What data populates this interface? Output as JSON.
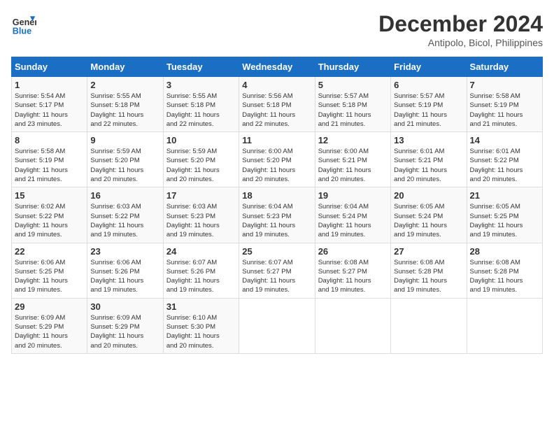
{
  "header": {
    "logo_line1": "General",
    "logo_line2": "Blue",
    "month": "December 2024",
    "location": "Antipolo, Bicol, Philippines"
  },
  "weekdays": [
    "Sunday",
    "Monday",
    "Tuesday",
    "Wednesday",
    "Thursday",
    "Friday",
    "Saturday"
  ],
  "weeks": [
    [
      {
        "day": 1,
        "sunrise": "5:54 AM",
        "sunset": "5:17 PM",
        "daylight": "11 hours and 23 minutes."
      },
      {
        "day": 2,
        "sunrise": "5:55 AM",
        "sunset": "5:18 PM",
        "daylight": "11 hours and 22 minutes."
      },
      {
        "day": 3,
        "sunrise": "5:55 AM",
        "sunset": "5:18 PM",
        "daylight": "11 hours and 22 minutes."
      },
      {
        "day": 4,
        "sunrise": "5:56 AM",
        "sunset": "5:18 PM",
        "daylight": "11 hours and 22 minutes."
      },
      {
        "day": 5,
        "sunrise": "5:57 AM",
        "sunset": "5:18 PM",
        "daylight": "11 hours and 21 minutes."
      },
      {
        "day": 6,
        "sunrise": "5:57 AM",
        "sunset": "5:19 PM",
        "daylight": "11 hours and 21 minutes."
      },
      {
        "day": 7,
        "sunrise": "5:58 AM",
        "sunset": "5:19 PM",
        "daylight": "11 hours and 21 minutes."
      }
    ],
    [
      {
        "day": 8,
        "sunrise": "5:58 AM",
        "sunset": "5:19 PM",
        "daylight": "11 hours and 21 minutes."
      },
      {
        "day": 9,
        "sunrise": "5:59 AM",
        "sunset": "5:20 PM",
        "daylight": "11 hours and 20 minutes."
      },
      {
        "day": 10,
        "sunrise": "5:59 AM",
        "sunset": "5:20 PM",
        "daylight": "11 hours and 20 minutes."
      },
      {
        "day": 11,
        "sunrise": "6:00 AM",
        "sunset": "5:20 PM",
        "daylight": "11 hours and 20 minutes."
      },
      {
        "day": 12,
        "sunrise": "6:00 AM",
        "sunset": "5:21 PM",
        "daylight": "11 hours and 20 minutes."
      },
      {
        "day": 13,
        "sunrise": "6:01 AM",
        "sunset": "5:21 PM",
        "daylight": "11 hours and 20 minutes."
      },
      {
        "day": 14,
        "sunrise": "6:01 AM",
        "sunset": "5:22 PM",
        "daylight": "11 hours and 20 minutes."
      }
    ],
    [
      {
        "day": 15,
        "sunrise": "6:02 AM",
        "sunset": "5:22 PM",
        "daylight": "11 hours and 19 minutes."
      },
      {
        "day": 16,
        "sunrise": "6:03 AM",
        "sunset": "5:22 PM",
        "daylight": "11 hours and 19 minutes."
      },
      {
        "day": 17,
        "sunrise": "6:03 AM",
        "sunset": "5:23 PM",
        "daylight": "11 hours and 19 minutes."
      },
      {
        "day": 18,
        "sunrise": "6:04 AM",
        "sunset": "5:23 PM",
        "daylight": "11 hours and 19 minutes."
      },
      {
        "day": 19,
        "sunrise": "6:04 AM",
        "sunset": "5:24 PM",
        "daylight": "11 hours and 19 minutes."
      },
      {
        "day": 20,
        "sunrise": "6:05 AM",
        "sunset": "5:24 PM",
        "daylight": "11 hours and 19 minutes."
      },
      {
        "day": 21,
        "sunrise": "6:05 AM",
        "sunset": "5:25 PM",
        "daylight": "11 hours and 19 minutes."
      }
    ],
    [
      {
        "day": 22,
        "sunrise": "6:06 AM",
        "sunset": "5:25 PM",
        "daylight": "11 hours and 19 minutes."
      },
      {
        "day": 23,
        "sunrise": "6:06 AM",
        "sunset": "5:26 PM",
        "daylight": "11 hours and 19 minutes."
      },
      {
        "day": 24,
        "sunrise": "6:07 AM",
        "sunset": "5:26 PM",
        "daylight": "11 hours and 19 minutes."
      },
      {
        "day": 25,
        "sunrise": "6:07 AM",
        "sunset": "5:27 PM",
        "daylight": "11 hours and 19 minutes."
      },
      {
        "day": 26,
        "sunrise": "6:08 AM",
        "sunset": "5:27 PM",
        "daylight": "11 hours and 19 minutes."
      },
      {
        "day": 27,
        "sunrise": "6:08 AM",
        "sunset": "5:28 PM",
        "daylight": "11 hours and 19 minutes."
      },
      {
        "day": 28,
        "sunrise": "6:08 AM",
        "sunset": "5:28 PM",
        "daylight": "11 hours and 19 minutes."
      }
    ],
    [
      {
        "day": 29,
        "sunrise": "6:09 AM",
        "sunset": "5:29 PM",
        "daylight": "11 hours and 20 minutes."
      },
      {
        "day": 30,
        "sunrise": "6:09 AM",
        "sunset": "5:29 PM",
        "daylight": "11 hours and 20 minutes."
      },
      {
        "day": 31,
        "sunrise": "6:10 AM",
        "sunset": "5:30 PM",
        "daylight": "11 hours and 20 minutes."
      },
      null,
      null,
      null,
      null
    ]
  ]
}
